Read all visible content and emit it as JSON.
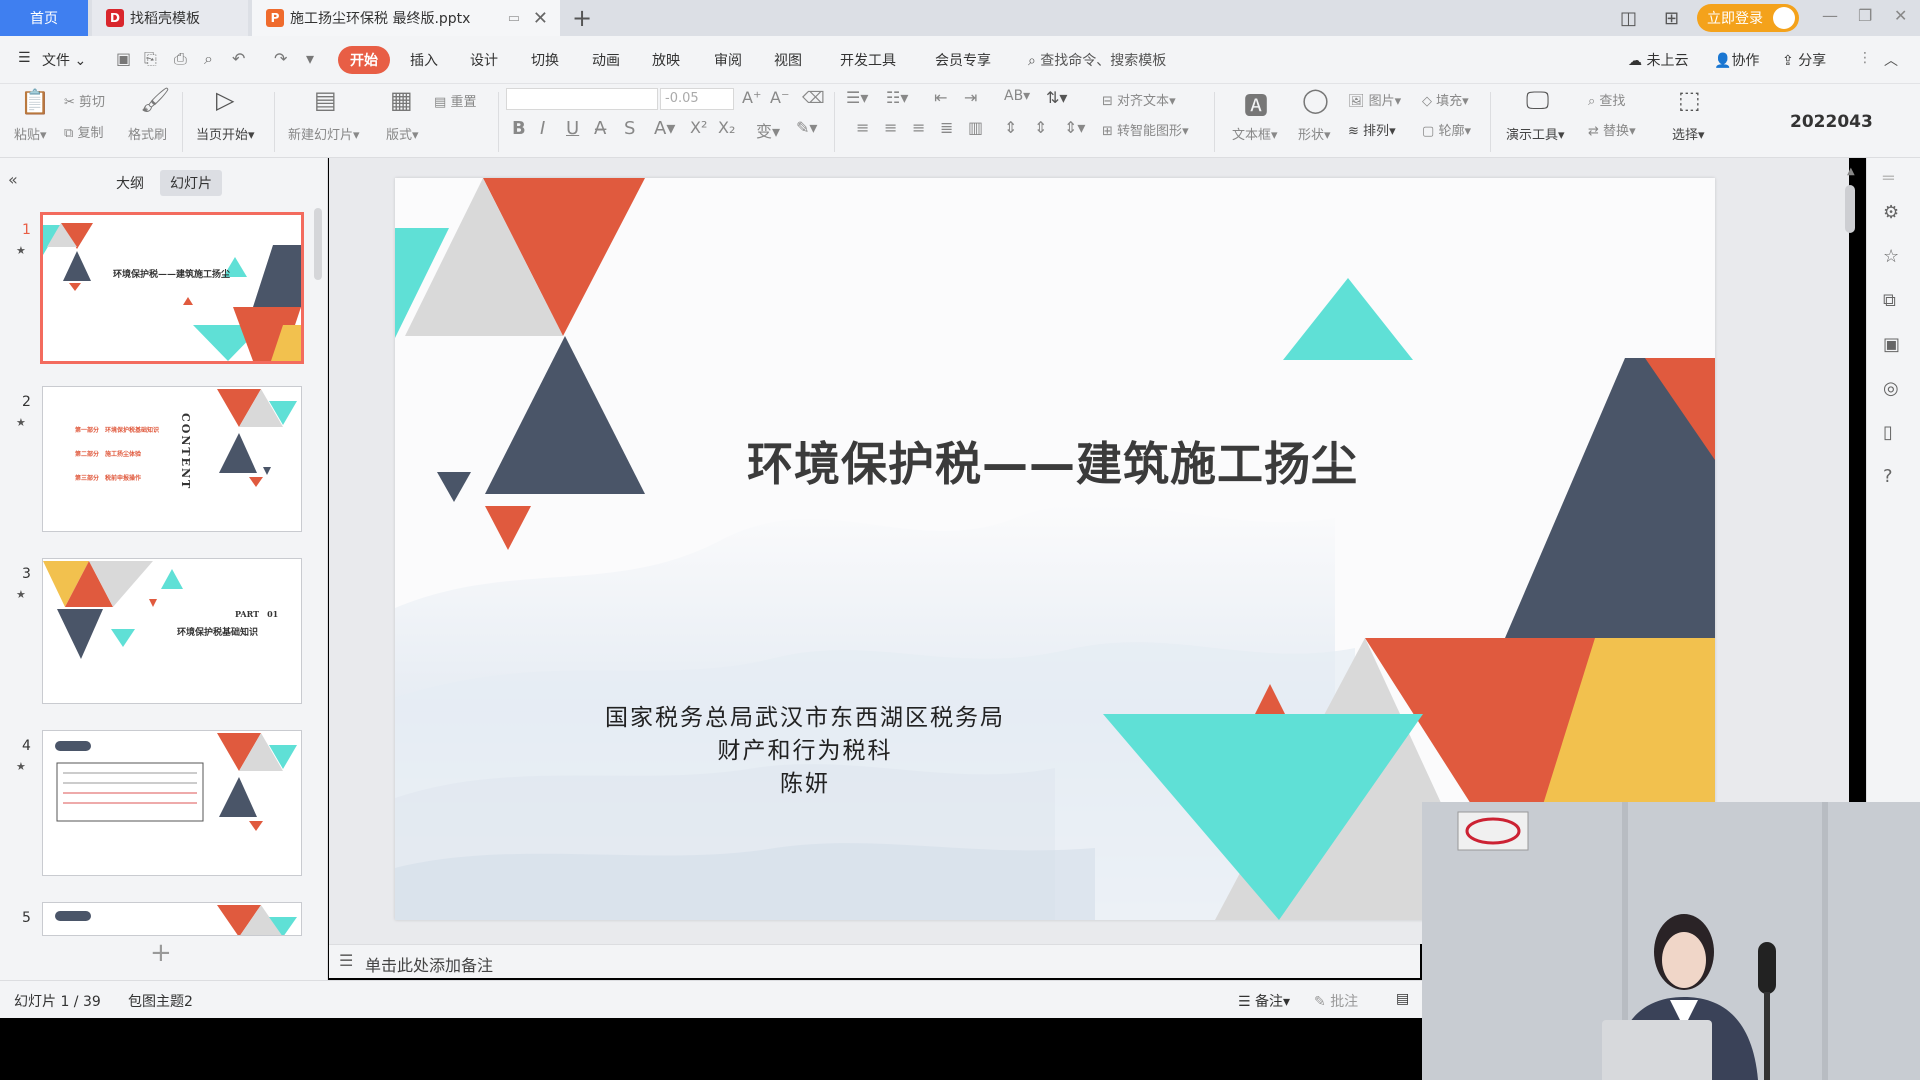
{
  "tabs": {
    "home": "首页",
    "template": "找稻壳模板",
    "document": "施工扬尘环保税 最终版.pptx"
  },
  "titlebar": {
    "login": "立即登录"
  },
  "menu": {
    "file": "文件",
    "items": [
      "开始",
      "插入",
      "设计",
      "切换",
      "动画",
      "放映",
      "审阅",
      "视图",
      "开发工具",
      "会员专享"
    ],
    "search": "查找命令、搜索模板",
    "cloud": "未上云",
    "collab": "协作",
    "share": "分享"
  },
  "ribbon": {
    "paste": "粘贴",
    "cut": "剪切",
    "copy": "复制",
    "format_painter": "格式刷",
    "from_current": "当页开始",
    "new_slide": "新建幻灯片",
    "layout": "版式",
    "reset": "重置",
    "font_size": "-0.05",
    "align_text": "对齐文本",
    "smart_shape": "转智能图形",
    "textbox": "文本框",
    "shape": "形状",
    "picture": "图片",
    "fill": "填充",
    "arrange": "排列",
    "outline": "轮廓",
    "presenter_tools": "演示工具",
    "find": "查找",
    "replace": "替换",
    "select": "选择",
    "date": "2022043"
  },
  "left_panel": {
    "outline_tab": "大纲",
    "slides_tab": "幻灯片",
    "thumbs": [
      {
        "num": "1",
        "title": "环境保护税——建筑施工扬尘"
      },
      {
        "num": "2",
        "title": "CONTENT",
        "lines": [
          "第一部分　环境保护税基础知识",
          "第二部分　施工扬尘体验",
          "第三部分　税前申报操作"
        ]
      },
      {
        "num": "3",
        "title": "环境保护税基础知识",
        "part": "PART　01"
      },
      {
        "num": "4"
      },
      {
        "num": "5"
      }
    ]
  },
  "slide": {
    "title": "环境保护税——建筑施工扬尘",
    "subtitle_lines": [
      "国家税务总局武汉市东西湖区税务局",
      "财产和行为税科",
      "陈妍"
    ]
  },
  "notes": {
    "placeholder": "单击此处添加备注"
  },
  "status": {
    "slide_index": "幻灯片 1 / 39",
    "theme": "包图主题2",
    "notes": "备注",
    "comments": "批注"
  },
  "colors": {
    "accent_red": "#e05a3e",
    "navy": "#4a5568",
    "teal": "#5fe0d6",
    "gray": "#d9d9d9",
    "yellow": "#f2c14e",
    "tab_blue": "#3f7ff0",
    "login_orange": "#f4a21b"
  }
}
